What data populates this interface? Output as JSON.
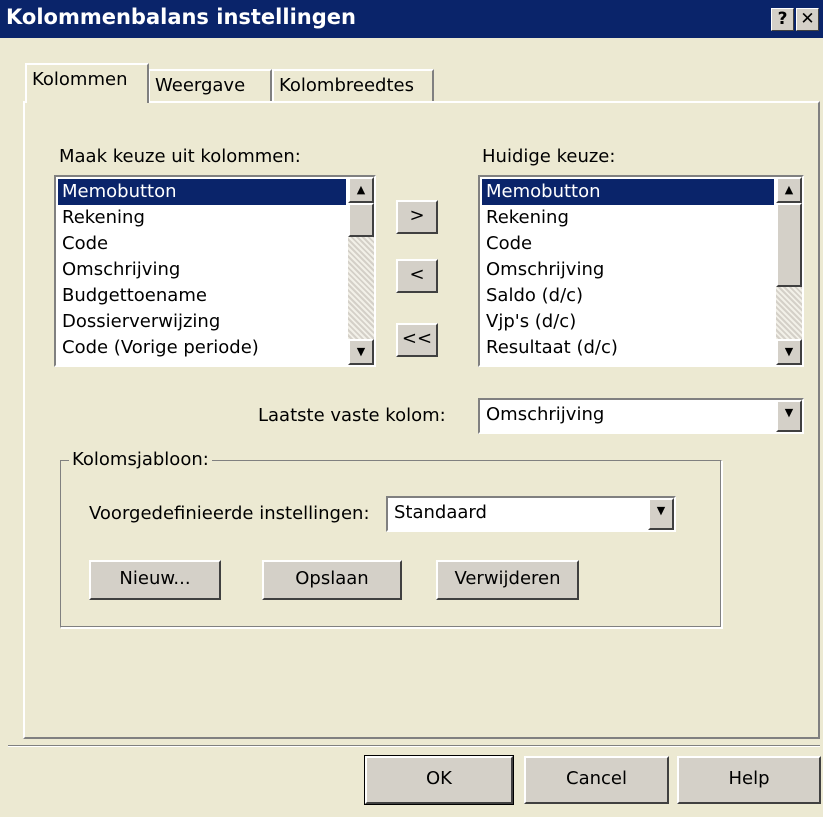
{
  "window": {
    "title": "Kolommenbalans instellingen",
    "help_glyph": "?",
    "close_glyph": "✕"
  },
  "tabs": [
    {
      "label": "Kolommen",
      "active": true
    },
    {
      "label": "Weergave",
      "active": false
    },
    {
      "label": "Kolombreedtes",
      "active": false
    }
  ],
  "available": {
    "label": "Maak keuze uit kolommen:",
    "items": [
      "Memobutton",
      "Rekening",
      "Code",
      "Omschrijving",
      "Budgettoename",
      "Dossierverwijzing",
      "Code (Vorige periode)"
    ],
    "selected_index": 0
  },
  "move_buttons": {
    "add": ">",
    "remove": "<",
    "remove_all": "<<"
  },
  "current": {
    "label": "Huidige keuze:",
    "items": [
      "Memobutton",
      "Rekening",
      "Code",
      "Omschrijving",
      "Saldo (d/c)",
      "Vjp's (d/c)",
      "Resultaat (d/c)"
    ],
    "selected_index": 0
  },
  "last_fixed_column": {
    "label": "Laatste vaste kolom:",
    "value": "Omschrijving"
  },
  "template_group": {
    "title": "Kolomsjabloon:",
    "predefined_label": "Voorgedefinieerde instellingen:",
    "predefined_value": "Standaard",
    "new_button": "Nieuw...",
    "save_button": "Opslaan",
    "delete_button": "Verwijderen"
  },
  "footer": {
    "ok": "OK",
    "cancel": "Cancel",
    "help": "Help"
  },
  "colors": {
    "titlebar": "#0a246a",
    "face": "#ece9d2",
    "selection": "#0a246a"
  }
}
